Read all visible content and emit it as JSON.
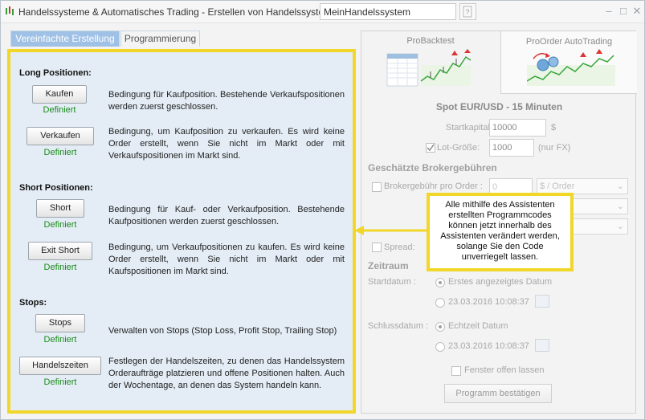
{
  "window": {
    "title": "Handelssysteme & Automatisches Trading - Erstellen von Handelssystemen",
    "name_value": "MeinHandelssystem",
    "separator": "-"
  },
  "tabs": [
    {
      "label": "Vereinfachte Erstellung",
      "active": true
    },
    {
      "label": "Programmierung",
      "active": false
    }
  ],
  "left": {
    "long_title": "Long Positionen:",
    "short_title": "Short Positionen:",
    "stops_title": "Stops:",
    "items": [
      {
        "button": "Kaufen",
        "status": "Definiert",
        "description": "Bedingung für Kaufposition. Bestehende Verkaufspositionen werden zuerst geschlossen."
      },
      {
        "button": "Verkaufen",
        "status": "Definiert",
        "description": "Bedingung, um Kaufposition zu verkaufen. Es wird keine Order erstellt, wenn Sie nicht im Markt oder mit Verkaufspositionen im Markt sind."
      },
      {
        "button": "Short",
        "status": "Definiert",
        "description": "Bedingung für Kauf- oder Verkaufposition. Bestehende Kaufpositionen werden zuerst geschlossen."
      },
      {
        "button": "Exit Short",
        "status": "Definiert",
        "description": "Bedingung, um Verkaufpositionen zu kaufen. Es wird keine Order erstellt, wenn Sie nicht im Markt oder mit Kaufspositionen im Markt sind."
      },
      {
        "button": "Stops",
        "status": "Definiert",
        "description": "Verwalten von Stops (Stop Loss, Profit Stop, Trailing Stop)"
      },
      {
        "button": "Handelszeiten",
        "status": "Definiert",
        "description": "Festlegen der Handelszeiten, zu denen das Handelssystem Orderaufträge platzieren und offene Positionen halten. Auch der Wochentage, an denen das System handeln kann."
      }
    ]
  },
  "right": {
    "tab_backtest": "ProBacktest",
    "tab_autotrading": "ProOrder AutoTrading",
    "instrument": "Spot EUR/USD - 15 Minuten",
    "startkapital_label": "Startkapital :",
    "startkapital_value": "10000",
    "startkapital_unit": "$",
    "lot_label": "Lot-Größe:",
    "lot_value": "1000",
    "lot_unit": "(nur FX)",
    "lot_checked": true,
    "fees_title": "Geschätzte Brokergebühren",
    "broker_fee_label": "Brokergebühr pro Order :",
    "broker_fee_value": "0",
    "broker_fee_unit": "$ / Order",
    "spread_label": "Spread:",
    "zeitraum_title": "Zeitraum",
    "startdatum_label": "Startdatum :",
    "start_option_1": "Erstes angezeigtes Datum",
    "start_option_2": "23.03.2016 10:08:37",
    "schluss_label": "Schlussdatum :",
    "end_option_1": "Echtzeit Datum",
    "end_option_2": "23.03.2016 10:08:37",
    "keep_open_label": "Fenster offen lassen",
    "confirm_label": "Programm bestätigen"
  },
  "tooltip": {
    "text": "Alle mithilfe des Assistenten erstellten Programmcodes können jetzt innerhalb des Assistenten verändert werden, solange Sie den Code unverriegelt lassen."
  },
  "colors": {
    "highlight": "#f0d72a",
    "defined_green": "#1a8a1a",
    "tab_active": "#9fc1e6",
    "panel_bg": "#e4edf6"
  }
}
